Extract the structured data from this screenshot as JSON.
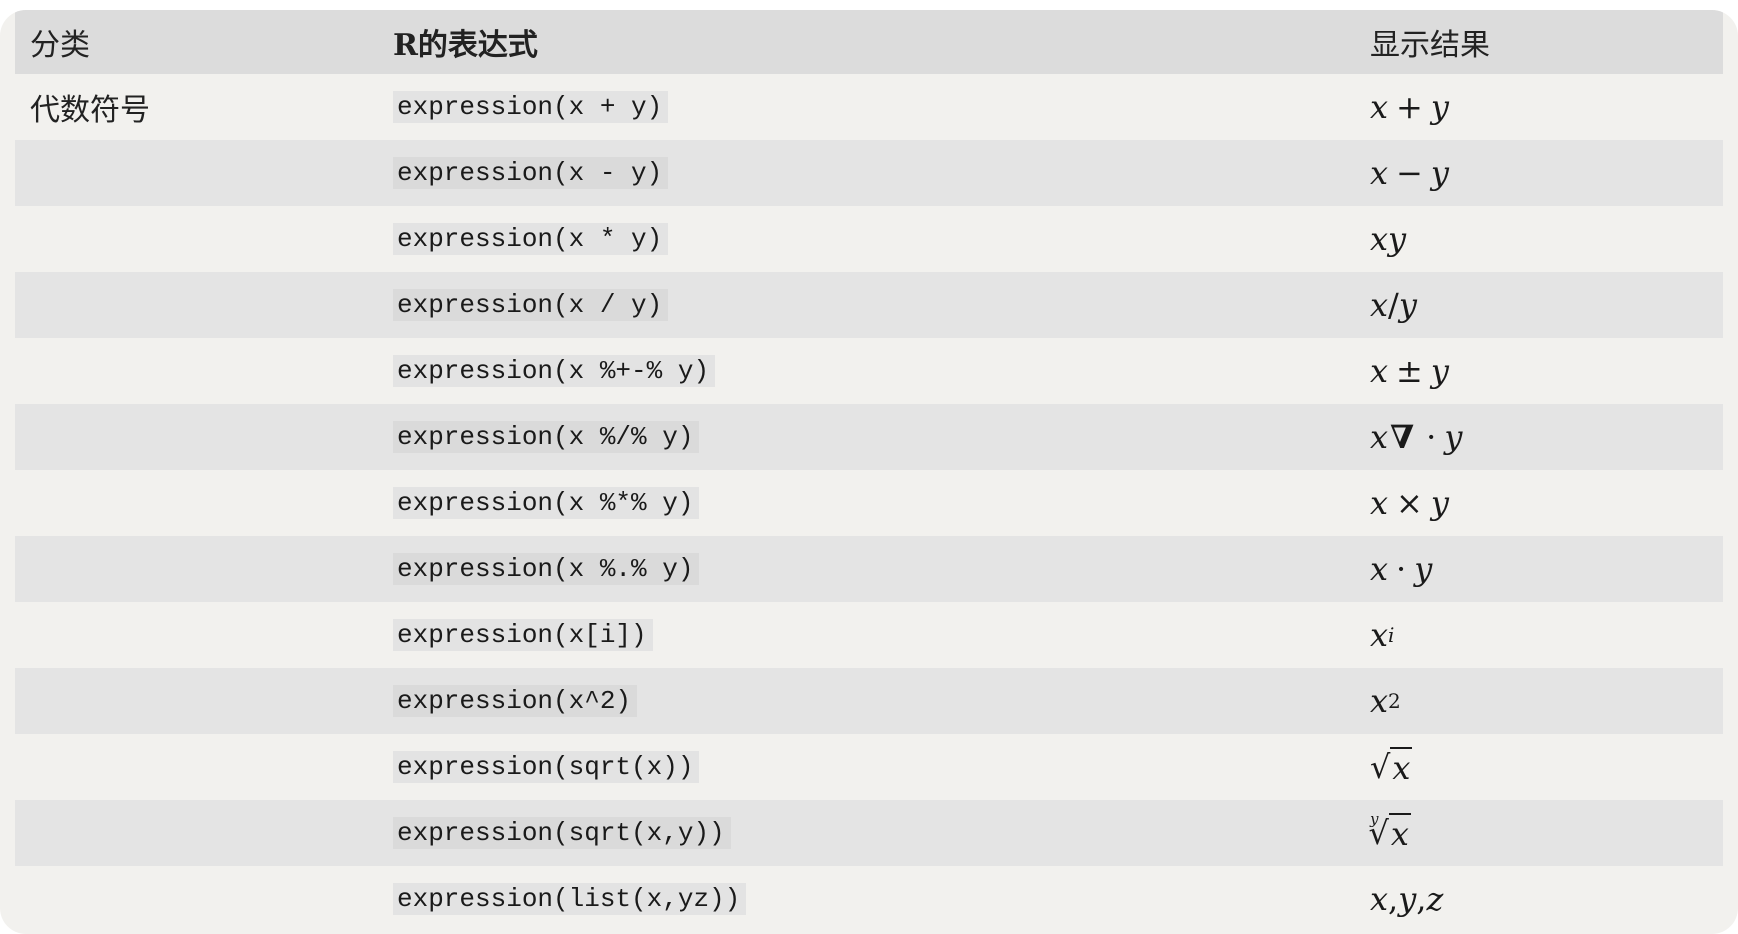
{
  "table": {
    "headers": {
      "category": "分类",
      "expression": "R的表达式",
      "result": "显示结果"
    },
    "category_label": "代数符号",
    "rows": [
      {
        "code": "expression(x + y)"
      },
      {
        "code": "expression(x - y)"
      },
      {
        "code": "expression(x * y)"
      },
      {
        "code": "expression(x / y)"
      },
      {
        "code": "expression(x %+-% y)"
      },
      {
        "code": "expression(x %/% y)"
      },
      {
        "code": "expression(x %*% y)"
      },
      {
        "code": "expression(x %.% y)"
      },
      {
        "code": "expression(x[i])"
      },
      {
        "code": "expression(x^2)"
      },
      {
        "code": "expression(sqrt(x))"
      },
      {
        "code": "expression(sqrt(x,y))"
      },
      {
        "code": "expression(list(x,yz))"
      }
    ],
    "results": {
      "r0": {
        "a": "x",
        "op": "+",
        "b": "y"
      },
      "r1": {
        "a": "x",
        "op": "−",
        "b": "y"
      },
      "r2": {
        "a": "xy"
      },
      "r3": {
        "a": "x",
        "op": "/",
        "b": "y"
      },
      "r4": {
        "a": "x",
        "op": "±",
        "b": "y"
      },
      "r5": {
        "a": "x",
        "nabla": "∇",
        "op": "·",
        "b": "y"
      },
      "r6": {
        "a": "x",
        "op": "×",
        "b": "y"
      },
      "r7": {
        "a": "x",
        "op": "·",
        "b": "y"
      },
      "r8": {
        "a": "x",
        "sub": "i"
      },
      "r9": {
        "a": "x",
        "sup": "2"
      },
      "r10": {
        "rad": "√",
        "a": "x"
      },
      "r11": {
        "index": "y",
        "rad": "√",
        "a": "x"
      },
      "r12": {
        "a": "x",
        "s1": ",",
        "b": "y",
        "s2": ",",
        "c": "z"
      }
    }
  }
}
